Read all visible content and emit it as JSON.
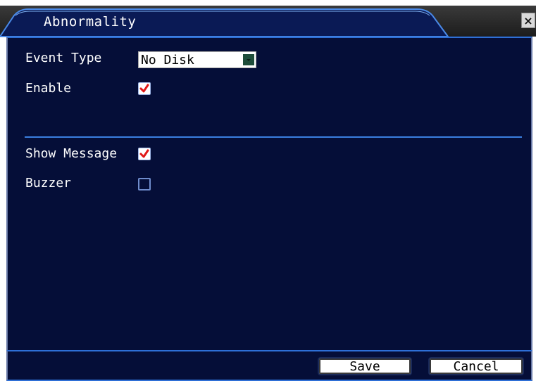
{
  "window": {
    "title": "Abnormality",
    "close_glyph": "×"
  },
  "form": {
    "event_type_label": "Event Type",
    "event_type_value": "No Disk",
    "enable_label": "Enable",
    "enable_checked": true,
    "show_message_label": "Show Message",
    "show_message_checked": true,
    "buzzer_label": "Buzzer",
    "buzzer_checked": false
  },
  "footer": {
    "save_label": "Save",
    "cancel_label": "Cancel"
  },
  "colors": {
    "panel_bg": "#050e38",
    "accent_blue": "#2e6fd6",
    "check_red": "#e01818"
  },
  "icons": {
    "check": "check-icon",
    "close": "close-icon",
    "dropdown": "chevron-down-icon"
  }
}
